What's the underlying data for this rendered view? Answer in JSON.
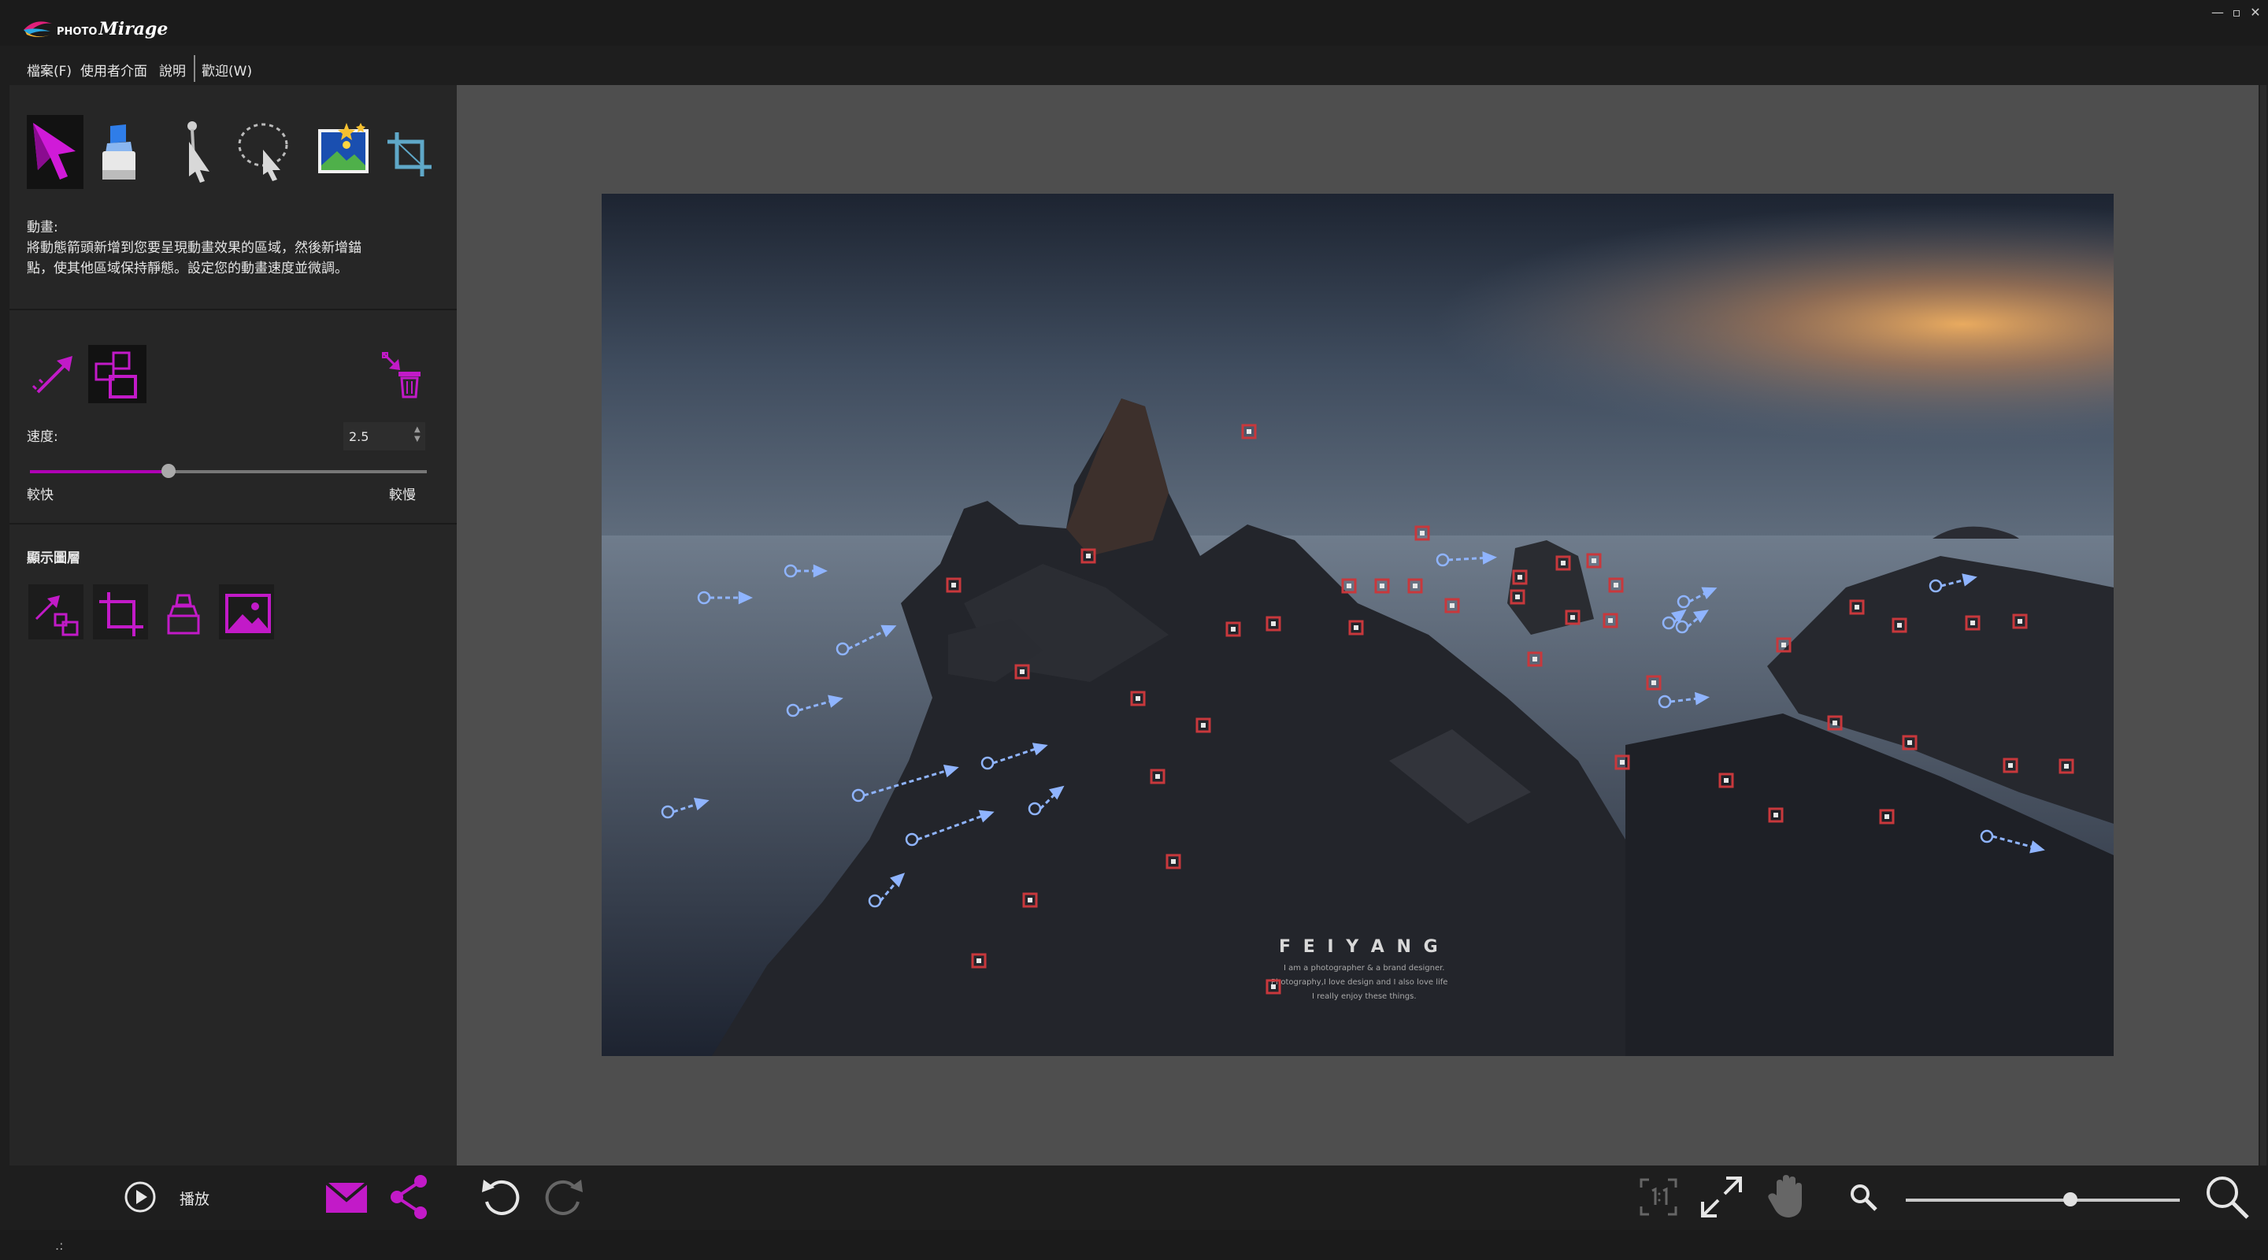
{
  "app": {
    "name_small": "PHOTO",
    "name": "Mirage"
  },
  "window_controls": {
    "minimize": "—",
    "maximize": "▫",
    "close": "✕"
  },
  "menu": [
    {
      "label": "檔案(F)"
    },
    {
      "label": "使用者介面"
    },
    {
      "label": "說明"
    },
    {
      "label": "歡迎(W)"
    }
  ],
  "tools": [
    {
      "icon": "motion-arrow-icon",
      "selected": true
    },
    {
      "icon": "eraser-icon"
    },
    {
      "icon": "anchor-point-icon"
    },
    {
      "icon": "lasso-select-icon"
    },
    {
      "icon": "sky-animation-icon"
    },
    {
      "icon": "crop-icon"
    }
  ],
  "help": {
    "title": "動畫:",
    "line1": "將動態箭頭新增到您要呈現動畫效果的區域，然後新增錨",
    "line2": "點，使其他區域保持靜態。設定您的動畫速度並微調。"
  },
  "motion_tools": [
    {
      "icon": "add-motion-arrow-icon"
    },
    {
      "icon": "select-anchor-icon",
      "selected": true
    },
    {
      "icon": "delete-arrows-icon"
    }
  ],
  "speed": {
    "label": "速度:",
    "value": "2.5",
    "slider_fraction": 0.35,
    "min_label": "較快",
    "max_label": "較慢"
  },
  "layers": {
    "title": "顯示圖層",
    "buttons": [
      {
        "icon": "motion-layer-icon"
      },
      {
        "icon": "crop-layer-icon"
      },
      {
        "icon": "mask-layer-icon"
      },
      {
        "icon": "image-layer-icon"
      }
    ]
  },
  "photo": {
    "watermark_title": "F E I Y A N G",
    "watermark_line1": "I am a photographer & a brand designer.",
    "watermark_line2": "Photography,I love design and I also love life",
    "watermark_line3": "I really enjoy these things."
  },
  "bottom": {
    "play_label": "播放",
    "zoom_fraction": 0.6
  },
  "status": {
    "text": ".:"
  },
  "colors": {
    "accent": "#b000b5",
    "arrow": "#8fb4ff",
    "anchor": "#c8383c"
  }
}
